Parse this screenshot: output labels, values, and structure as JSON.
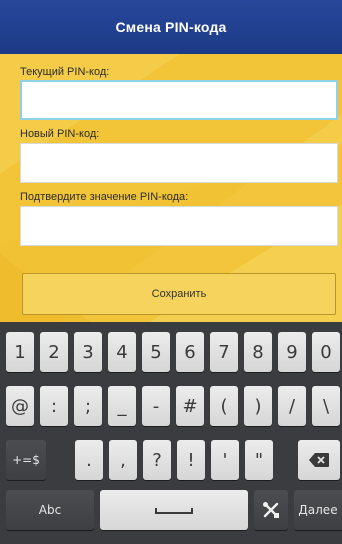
{
  "header": {
    "title": "Смена PIN-кода"
  },
  "form": {
    "current_pin": {
      "label": "Текущий PIN-код:",
      "value": ""
    },
    "new_pin": {
      "label": "Новый PIN-код:",
      "value": ""
    },
    "confirm_pin": {
      "label": "Подтвердите значение PIN-кода:",
      "value": ""
    },
    "save_label": "Сохранить"
  },
  "keyboard": {
    "row1": [
      "1",
      "2",
      "3",
      "4",
      "5",
      "6",
      "7",
      "8",
      "9",
      "0"
    ],
    "row2": [
      "@",
      ":",
      ";",
      "_",
      "-",
      "#",
      "(",
      ")",
      "/",
      "\\"
    ],
    "row3": {
      "shift_label": "+=$",
      "keys": [
        ".",
        ",",
        "?",
        "!",
        "'",
        "\""
      ],
      "backspace_icon": "backspace-icon"
    },
    "row4": {
      "mode_label": "Abc",
      "space_icon": "space-icon",
      "settings_icon": "tools-icon",
      "next_label": "Далее"
    }
  },
  "colors": {
    "header": "#1f3d8a",
    "form_background": "#f2c53a",
    "button": "#f5d35d",
    "keyboard": "#3b3c3f",
    "focus_border": "#8fd1e6"
  }
}
